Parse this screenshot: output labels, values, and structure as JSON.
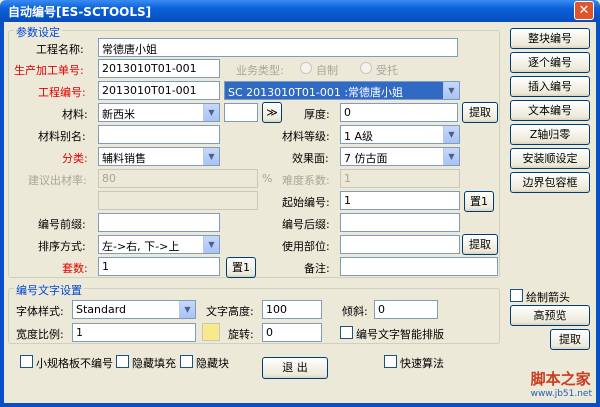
{
  "window": {
    "title": "自动编号[ES-SCTOOLS]",
    "close_glyph": "✕"
  },
  "params": {
    "legend": "参数设定",
    "project_name_label": "工程名称:",
    "project_name_value": "常德唐小姐",
    "order_no_label": "生产加工单号:",
    "order_no_value": "2013010T01-001",
    "business_type_label": "业务类型:",
    "radio_self": "自制",
    "radio_entrust": "受托",
    "project_no_label": "工程编号:",
    "project_no_value": "2013010T01-001",
    "project_no_select": "SC 2013010T01-001 :常德唐小姐",
    "material_label": "材料:",
    "material_value": "新西米",
    "more_button": "≫",
    "thickness_label": "厚度:",
    "thickness_value": "0",
    "fetch_button": "提取",
    "material_alias_label": "材料别名:",
    "material_alias_value": "",
    "material_grade_label": "材料等级:",
    "material_grade_value": "1 A级",
    "category_label": "分类:",
    "category_value": "辅料销售",
    "effect_label": "效果面:",
    "effect_value": "7 仿古面",
    "suggest_material_label": "建议出材率:",
    "suggest_material_value": "80",
    "percent_sign": "%",
    "difficulty_label": "难度系数:",
    "difficulty_value": "1",
    "extra_value": "",
    "start_no_label": "起始编号:",
    "start_no_value": "1",
    "set1_button": "置1",
    "prefix_label": "编号前缀:",
    "prefix_value": "",
    "suffix_label": "编号后缀:",
    "suffix_value": "",
    "sort_label": "排序方式:",
    "sort_value": "左->右, 下->上",
    "use_part_label": "使用部位:",
    "use_part_value": "",
    "fetch_button2": "提取",
    "count_label": "套数:",
    "count_value": "1",
    "set1_button2": "置1",
    "remark_label": "备注:",
    "remark_value": ""
  },
  "font_group": {
    "legend": "编号文字设置",
    "font_style_label": "字体样式:",
    "font_style_value": "Standard",
    "text_height_label": "文字高度:",
    "text_height_value": "100",
    "tilt_label": "倾斜:",
    "tilt_value": "0",
    "width_ratio_label": "宽度比例:",
    "width_ratio_value": "1",
    "rotate_label": "旋转:",
    "rotate_value": "0",
    "smart_layout_label": "编号文字智能排版"
  },
  "bottom": {
    "small_no_number": "小规格板不编号",
    "hide_fill": "隐藏填充",
    "hide_block": "隐藏块",
    "exit_button": "退  出",
    "fast_algo": "快速算法"
  },
  "side_buttons": {
    "whole_block": "整块编号",
    "one_by_one": "逐个编号",
    "insert": "插入编号",
    "text_edit": "文本编号",
    "z_axis": "Z轴归零",
    "install_seq": "安装顺设定",
    "border_wrap": "边界包容框",
    "draw_arrow": "绘制箭头",
    "preview": "高预览",
    "fetch": "提取"
  },
  "watermark": {
    "cn": "脚本之家",
    "url": "www.jb51.net"
  }
}
